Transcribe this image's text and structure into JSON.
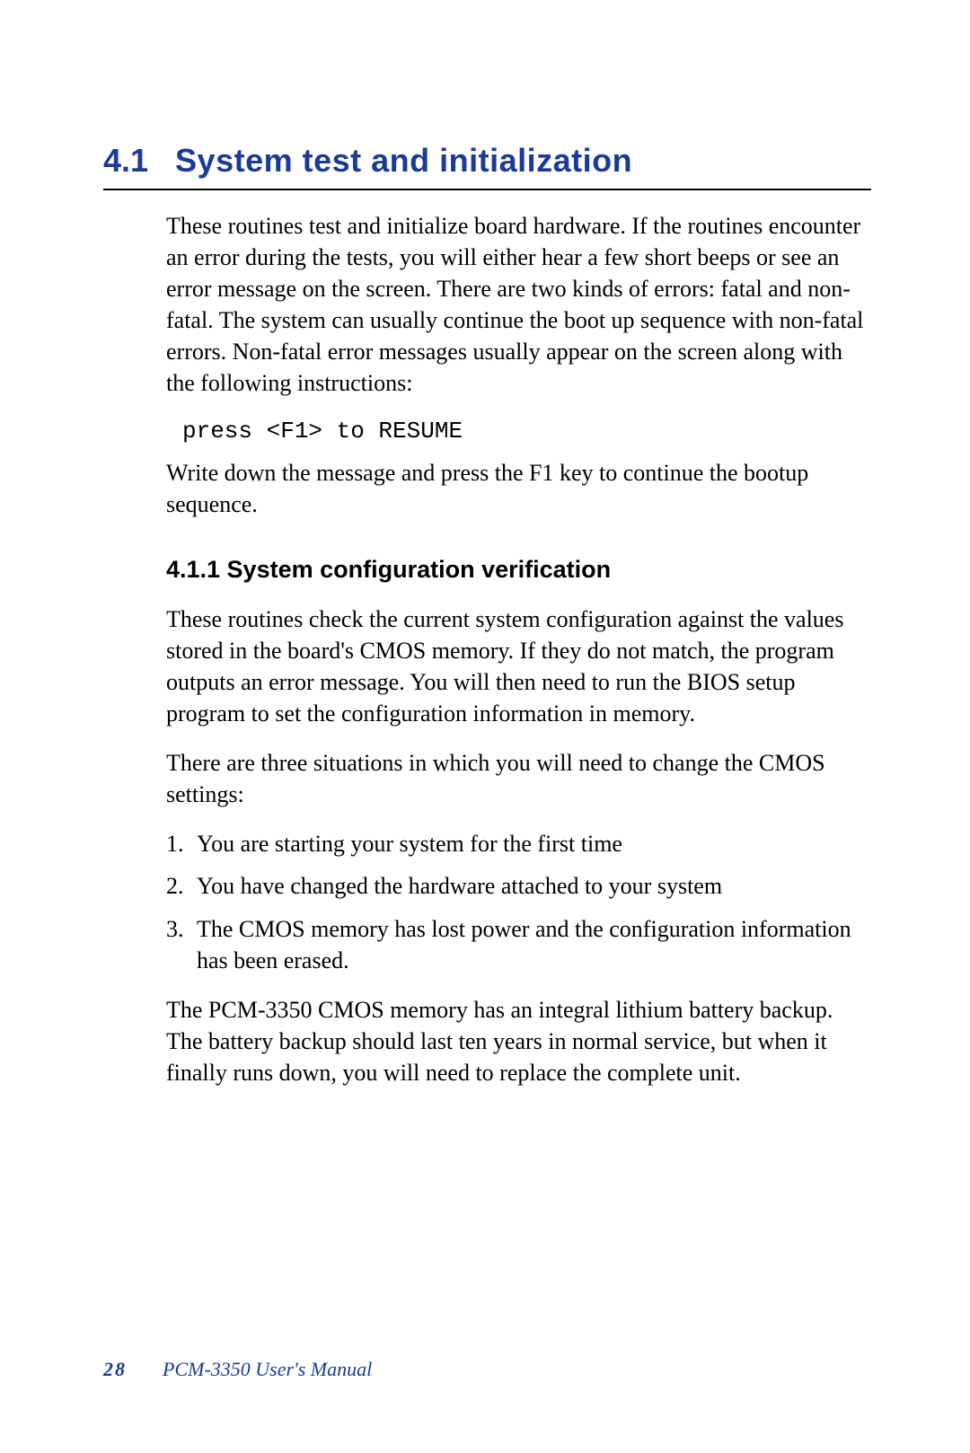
{
  "section": {
    "number": "4.1",
    "title": "System test and initialization",
    "intro_paragraph": "These routines test and initialize board hardware. If the routines encounter an error during the tests, you will either hear a few short beeps or see an error message on the screen. There are two kinds of errors: fatal and non-fatal. The system can usually continue the boot up sequence with non-fatal errors. Non-fatal error messages usually appear on the screen along with the following instructions:",
    "code_instruction": "press <F1> to RESUME",
    "post_code_paragraph": "Write down the message and press the F1 key to continue the bootup sequence.",
    "subsection": {
      "heading": "4.1.1 System configuration verification",
      "paragraph1": "These routines check the current system configuration against the values stored in the board's CMOS memory. If they do not match, the program outputs an error message. You will then need to run the BIOS setup program to set the configuration information in memory.",
      "paragraph2": "There are three situations in which you will need to change the CMOS settings:",
      "list": [
        "You are starting your system for the first time",
        "You have changed the hardware attached to your system",
        "The CMOS memory has lost power and the configuration information has been erased."
      ],
      "paragraph3": "The PCM-3350 CMOS memory has an integral lithium battery backup. The battery backup should last ten years in normal service, but when it finally runs down, you will need to replace the complete unit."
    }
  },
  "footer": {
    "page_number": "28",
    "manual_title": "PCM-3350  User's Manual"
  }
}
